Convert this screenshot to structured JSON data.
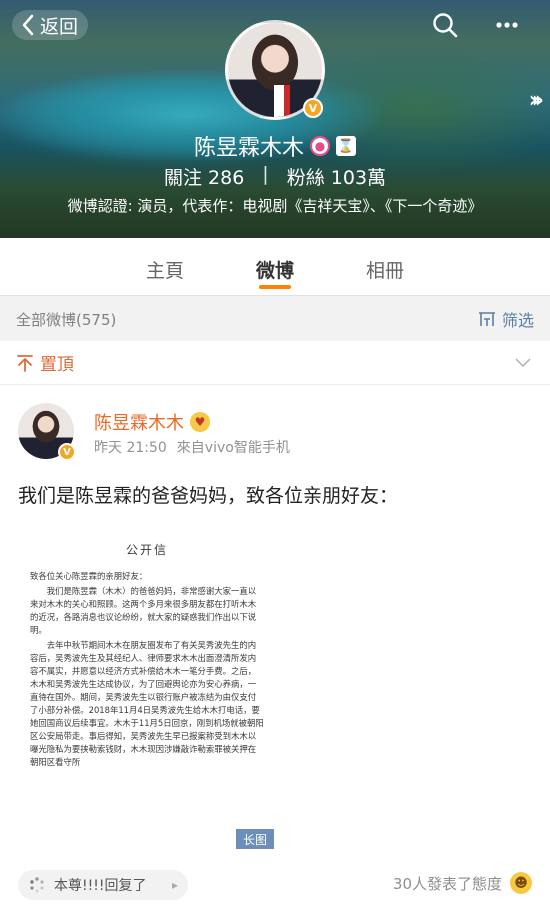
{
  "header": {
    "back_label": "返回",
    "profile_name": "陈昱霖木木",
    "follow_label": "關注",
    "follow_count": "286",
    "separator": "|",
    "fans_label": "粉絲",
    "fans_count": "103萬",
    "verification": "微博認證: 演员，代表作：电视剧《吉祥天宝》、《下一个奇迹》"
  },
  "tabs": [
    {
      "label": "主頁"
    },
    {
      "label": "微博"
    },
    {
      "label": "相冊"
    }
  ],
  "filter_bar": {
    "count_label": "全部微博(575)",
    "filter_label": "筛选"
  },
  "pinned": {
    "label": "置頂"
  },
  "post": {
    "author": "陈昱霖木木",
    "time": "昨天 21:50",
    "source": "來自vivo智能手机",
    "text": "我们是陈昱霖的爸爸妈妈，致各位亲朋好友：",
    "letter": {
      "title": "公开信",
      "salutation": "致各位关心陈昱霖的亲朋好友：",
      "paragraphs": [
        "我们是陈昱霖（木木）的爸爸妈妈，非常感谢大家一直以来对木木的关心和照顾。这两个多月来很多朋友都在打听木木的近况，各路消息也议论纷纷，就大家的疑惑我们作出以下说明。",
        "去年中秋节期间木木在朋友圈发布了有关吴秀波先生的内容后，吴秀波先生及其经纪人、律师要求木木出面澄清所发内容不属实，并愿意以经济方式补偿给木木一笔分手费。之后，木木和吴秀波先生达成协议，为了回避舆论亦为安心养病，一直待在国外。期间，吴秀波先生以银行账户被冻结为由仅支付了小部分补偿。2018年11月4日吴秀波先生给木木打电话，要她回国商议后续事宜。木木于11月5日回京，刚到机场就被朝阳区公安局带走。事后得知，吴秀波先生早已报案称受到木木以曝光隐私为要挟勒索钱财，木木现因涉嫌敲诈勒索罪被关押在朝阳区看守所"
      ],
      "long_badge": "长图"
    },
    "comment_preview": "本尊!!!!回复了",
    "reaction_text": "30人發表了態度"
  }
}
